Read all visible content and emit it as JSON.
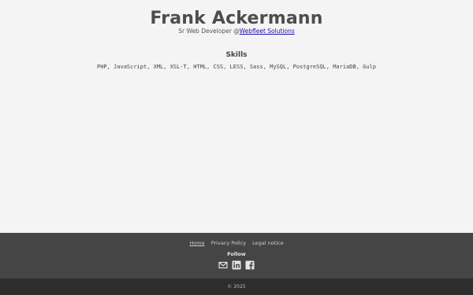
{
  "header": {
    "name": "Frank Ackermann",
    "role_prefix": "Sr Web Developer @",
    "company_link": "Webfleet Solutions"
  },
  "skills": {
    "title": "Skills",
    "list": "PHP, JavaScript, XML, XSL-T, HTML, CSS, LESS, Sass, MySQL, PostgreSQL, MariaDB, Gulp"
  },
  "footer": {
    "nav": {
      "home": "Home",
      "privacy": "Privacy Policy",
      "legal": "Legal notice"
    },
    "follow_label": "Follow",
    "social_icons": [
      "mail-icon",
      "linkedin-icon",
      "facebook-icon"
    ],
    "copyright": "© 2025"
  },
  "colors": {
    "background": "#f4f4f4",
    "footer": "#454545",
    "bottom_bar": "#2d2d2d",
    "link": "#1a0dab"
  }
}
